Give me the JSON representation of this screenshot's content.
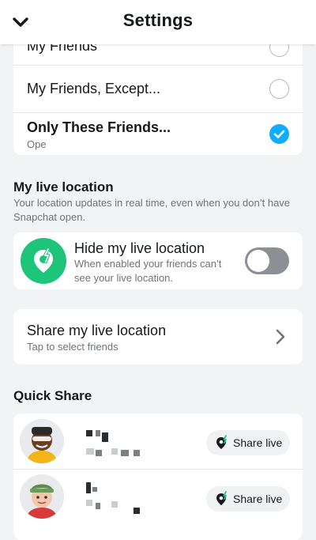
{
  "header": {
    "title": "Settings",
    "back_icon": "chevron-down-icon"
  },
  "visibility": {
    "options": [
      {
        "label": "My Friends",
        "checked": false
      },
      {
        "label": "My Friends, Except...",
        "checked": false
      },
      {
        "label": "Only These Friends...",
        "sublabel": "Ope",
        "checked": true
      }
    ]
  },
  "live_location": {
    "title": "My live location",
    "description": "Your location updates in real time, even when you don’t have Snapchat open.",
    "hide": {
      "label": "Hide my live location",
      "description": "When enabled your friends can’t see your live location.",
      "enabled": false,
      "icon": "location-off-icon",
      "icon_color": "#1ec47a"
    },
    "share": {
      "label": "Share my live location",
      "sublabel": "Tap to select friends"
    }
  },
  "quick_share": {
    "title": "Quick Share",
    "friends": [
      {
        "avatar": "bitmoji-avatar-1",
        "button_label": "Share live"
      },
      {
        "avatar": "bitmoji-avatar-2",
        "button_label": "Share live"
      }
    ]
  },
  "colors": {
    "accent": "#0fadff",
    "green": "#1ec47a",
    "toggle_off": "#8c9095"
  }
}
